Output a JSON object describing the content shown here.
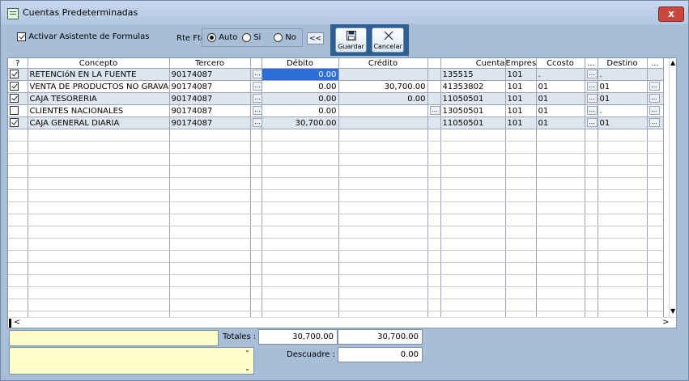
{
  "window": {
    "title": "Cuentas Predeterminadas",
    "close_label": "x"
  },
  "toolbar": {
    "wizard_label": "Activar Asistente de Formulas",
    "rte_label": "Rte Fte",
    "rte_options": [
      "Auto",
      "Si",
      "No"
    ],
    "rte_selected": "Auto",
    "collapse_label": "<<",
    "save_label": "Guardar",
    "cancel_label": "Cancelar"
  },
  "grid": {
    "columns": [
      "?",
      "Concepto",
      "Tercero",
      "",
      "Débito",
      "Crédito",
      "",
      "Cuenta",
      "Empresa",
      "Ccosto",
      "...",
      "Destino",
      "..."
    ],
    "rows": [
      {
        "checked": true,
        "concepto": "RETENCIóN EN LA FUENTE",
        "tercero": "90174087",
        "debito": "0.00",
        "credito": "",
        "cuenta": "135515",
        "empresa": "101",
        "ccosto": ".",
        "destino": "."
      },
      {
        "checked": true,
        "concepto": "VENTA DE PRODUCTOS NO GRAVADOS",
        "tercero": "90174087",
        "debito": "0.00",
        "credito": "30,700.00",
        "cuenta": "41353802",
        "empresa": "101",
        "ccosto": "01",
        "destino": "01"
      },
      {
        "checked": true,
        "concepto": "CAJA TESORERIA",
        "tercero": "90174087",
        "debito": "0.00",
        "credito": "0.00",
        "cuenta": "11050501",
        "empresa": "101",
        "ccosto": "01",
        "destino": "01"
      },
      {
        "checked": false,
        "concepto": "CLIENTES NACIONALES",
        "tercero": "90174087",
        "debito": "0.00",
        "credito": "",
        "cuenta": "13050501",
        "empresa": "101",
        "ccosto": "01",
        "destino": "."
      },
      {
        "checked": true,
        "concepto": "CAJA GENERAL DIARIA",
        "tercero": "90174087",
        "debito": "30,700.00",
        "credito": "",
        "cuenta": "11050501",
        "empresa": "101",
        "ccosto": "01",
        "destino": "01"
      }
    ]
  },
  "footer": {
    "totales_label": "Totales :",
    "total_debito": "30,700.00",
    "total_credito": "30,700.00",
    "descuadre_label": "Descuadre :",
    "descuadre": "0.00"
  },
  "colors": {
    "window_bg": "#a8bdd6",
    "selection": "#2d6fd8",
    "toolbar_bg": "#2e5f93",
    "close": "#c9463d"
  }
}
